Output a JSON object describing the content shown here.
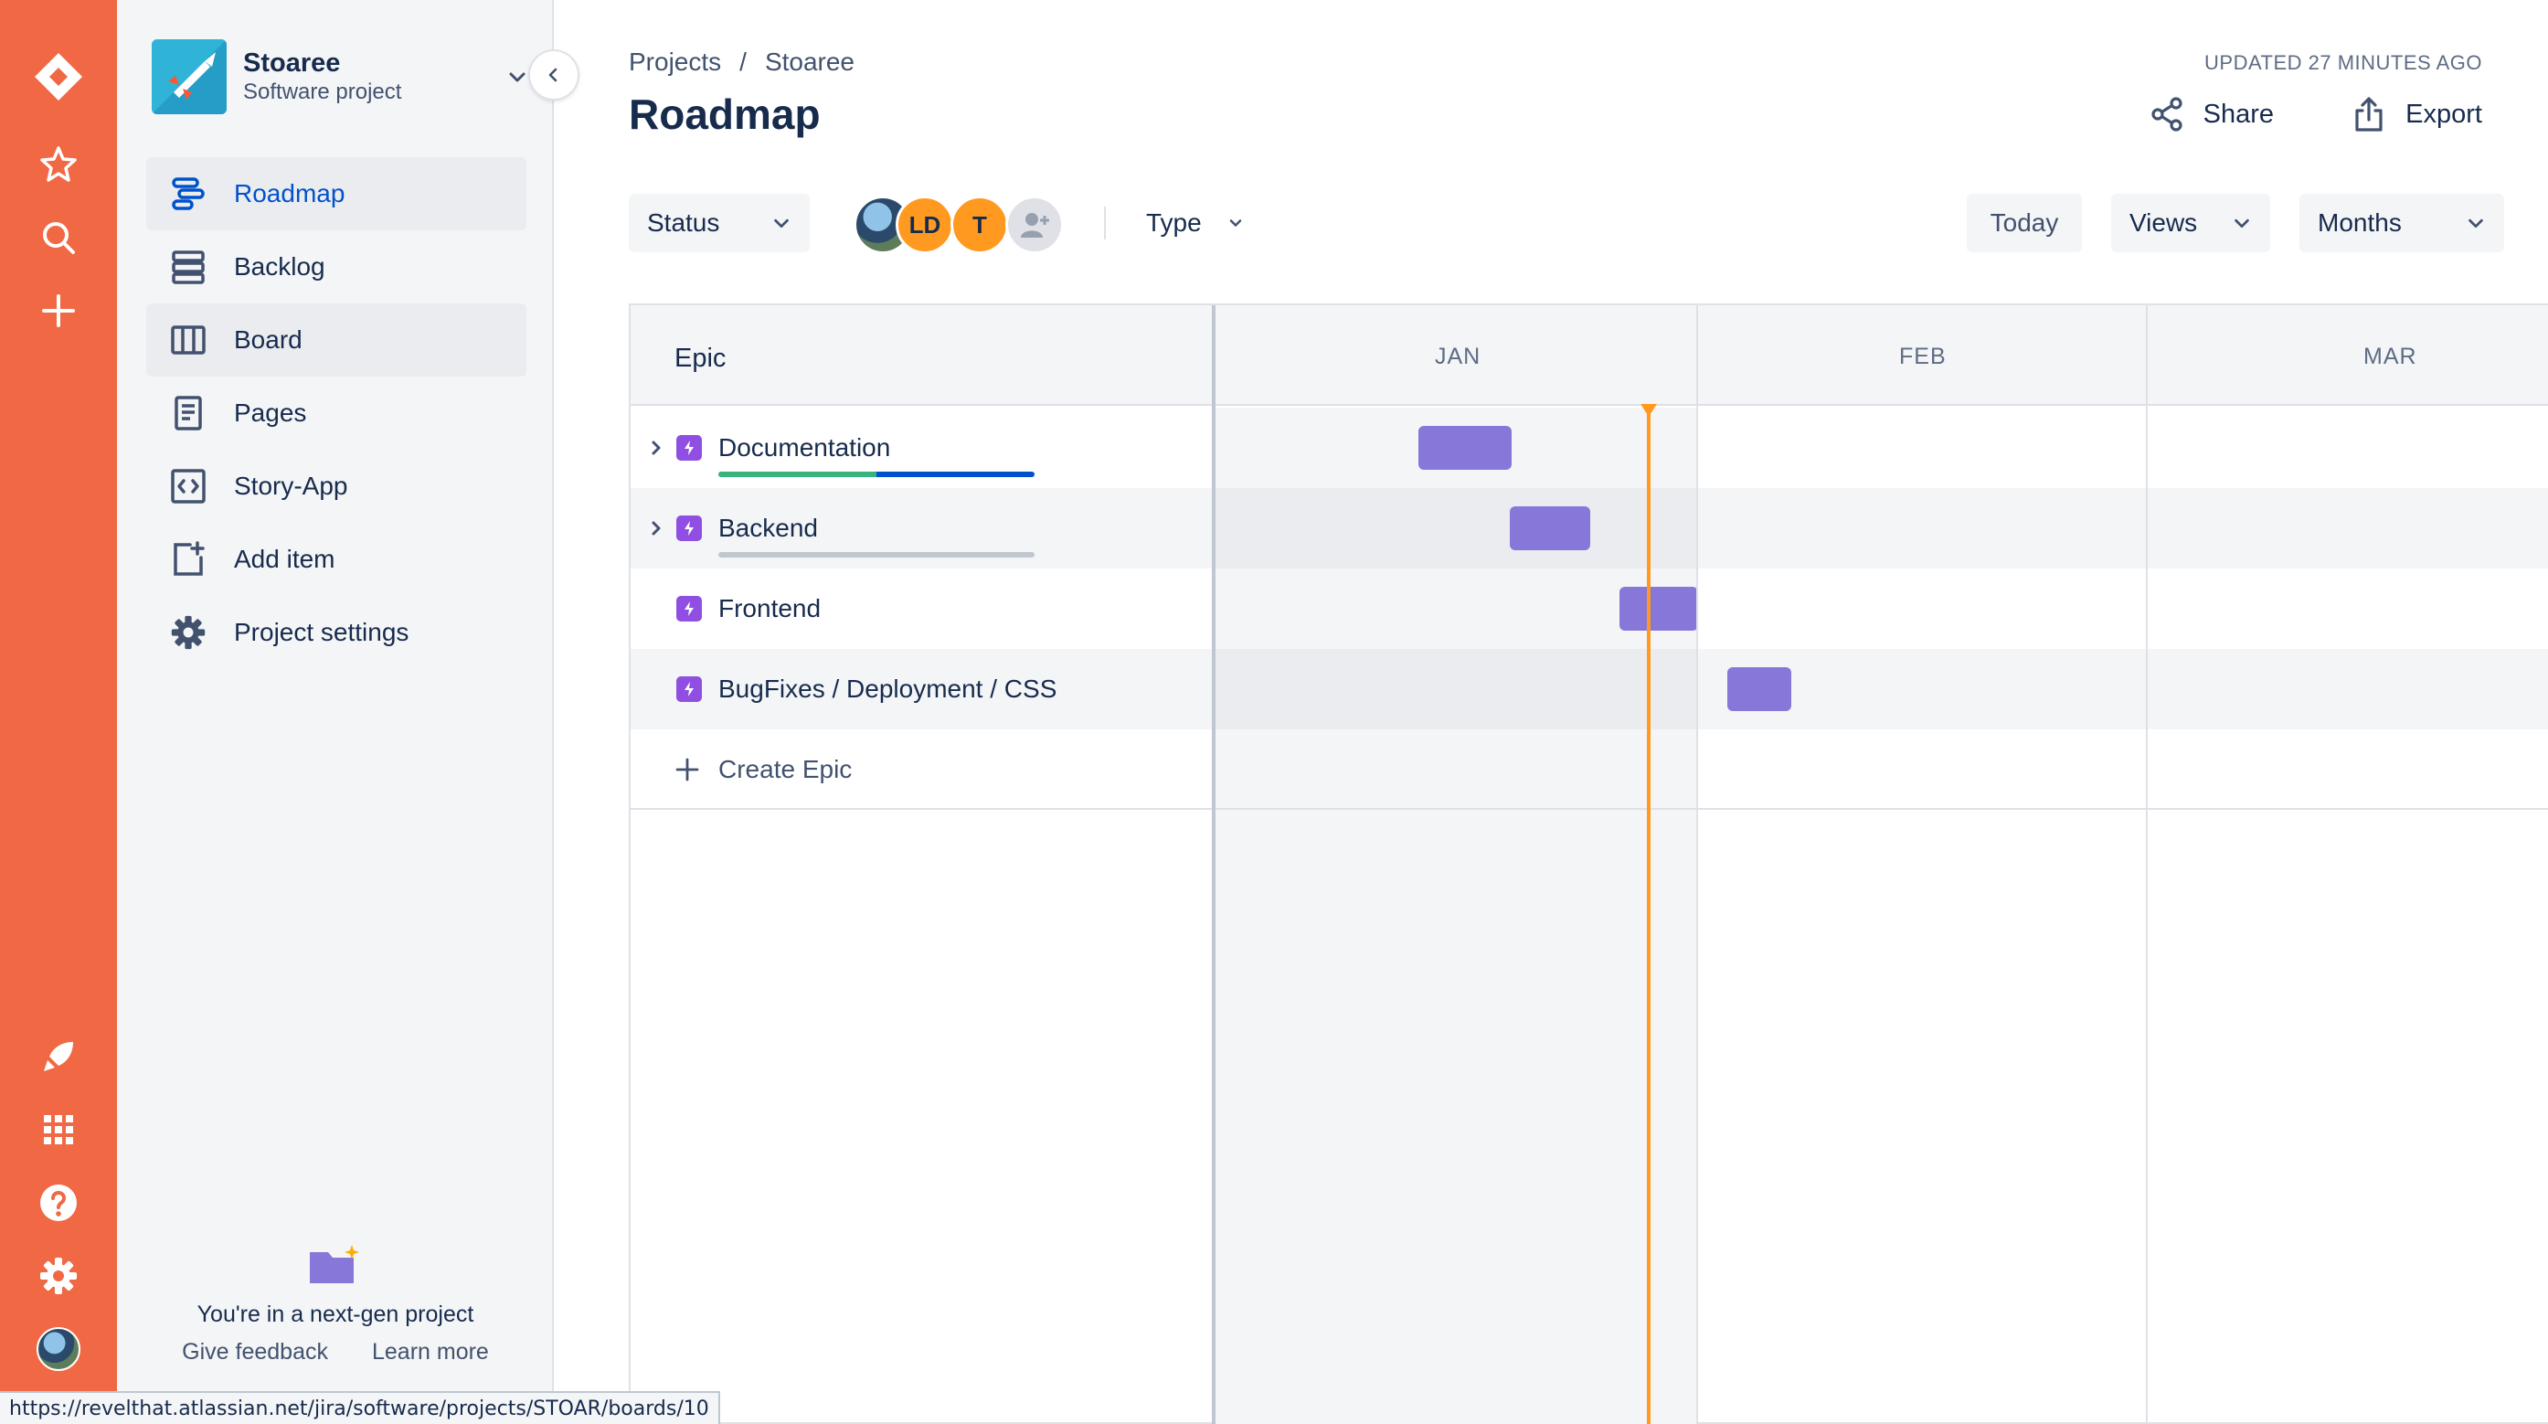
{
  "rail": {
    "icons": [
      "jira-logo-icon",
      "star-icon",
      "search-icon",
      "plus-icon",
      "rocket-icon",
      "app-switcher-icon",
      "help-icon",
      "settings-icon"
    ]
  },
  "project": {
    "name": "Stoaree",
    "type": "Software project"
  },
  "nav": [
    {
      "label": "Roadmap",
      "icon": "roadmap-icon",
      "active": true
    },
    {
      "label": "Backlog",
      "icon": "backlog-icon"
    },
    {
      "label": "Board",
      "icon": "board-icon"
    },
    {
      "label": "Pages",
      "icon": "pages-icon"
    },
    {
      "label": "Story-App",
      "icon": "code-icon"
    },
    {
      "label": "Add item",
      "icon": "add-item-icon"
    },
    {
      "label": "Project settings",
      "icon": "settings-icon"
    }
  ],
  "sidebar_footer": {
    "message": "You're in a next-gen project",
    "feedback": "Give feedback",
    "learn_more": "Learn more"
  },
  "breadcrumb": [
    "Projects",
    "/",
    "Stoaree"
  ],
  "page_title": "Roadmap",
  "updated": "UPDATED 27 MINUTES AGO",
  "header_actions": {
    "share": "Share",
    "export": "Export"
  },
  "filters": {
    "status": "Status",
    "type": "Type",
    "today": "Today",
    "views": "Views",
    "months": "Months",
    "avatars": [
      "LD",
      "T"
    ]
  },
  "roadmap": {
    "epic_header": "Epic",
    "months": [
      "JAN",
      "FEB",
      "MAR"
    ],
    "epics": [
      {
        "name": "Documentation",
        "expandable": true,
        "progress": {
          "done": 0.5,
          "in_progress": 0.5
        }
      },
      {
        "name": "Backend",
        "expandable": true,
        "progress": {
          "done": 0,
          "in_progress": 0
        }
      },
      {
        "name": "Frontend",
        "expandable": false
      },
      {
        "name": "BugFixes / Deployment / CSS",
        "expandable": false
      }
    ],
    "create_epic": "Create Epic",
    "colors": {
      "bar": "#8777d9",
      "epic_icon": "#904ee2",
      "today_line": "#ff991f",
      "rail": "#f06844"
    }
  },
  "status_url": "https://revelthat.atlassian.net/jira/software/projects/STOAR/boards/10"
}
